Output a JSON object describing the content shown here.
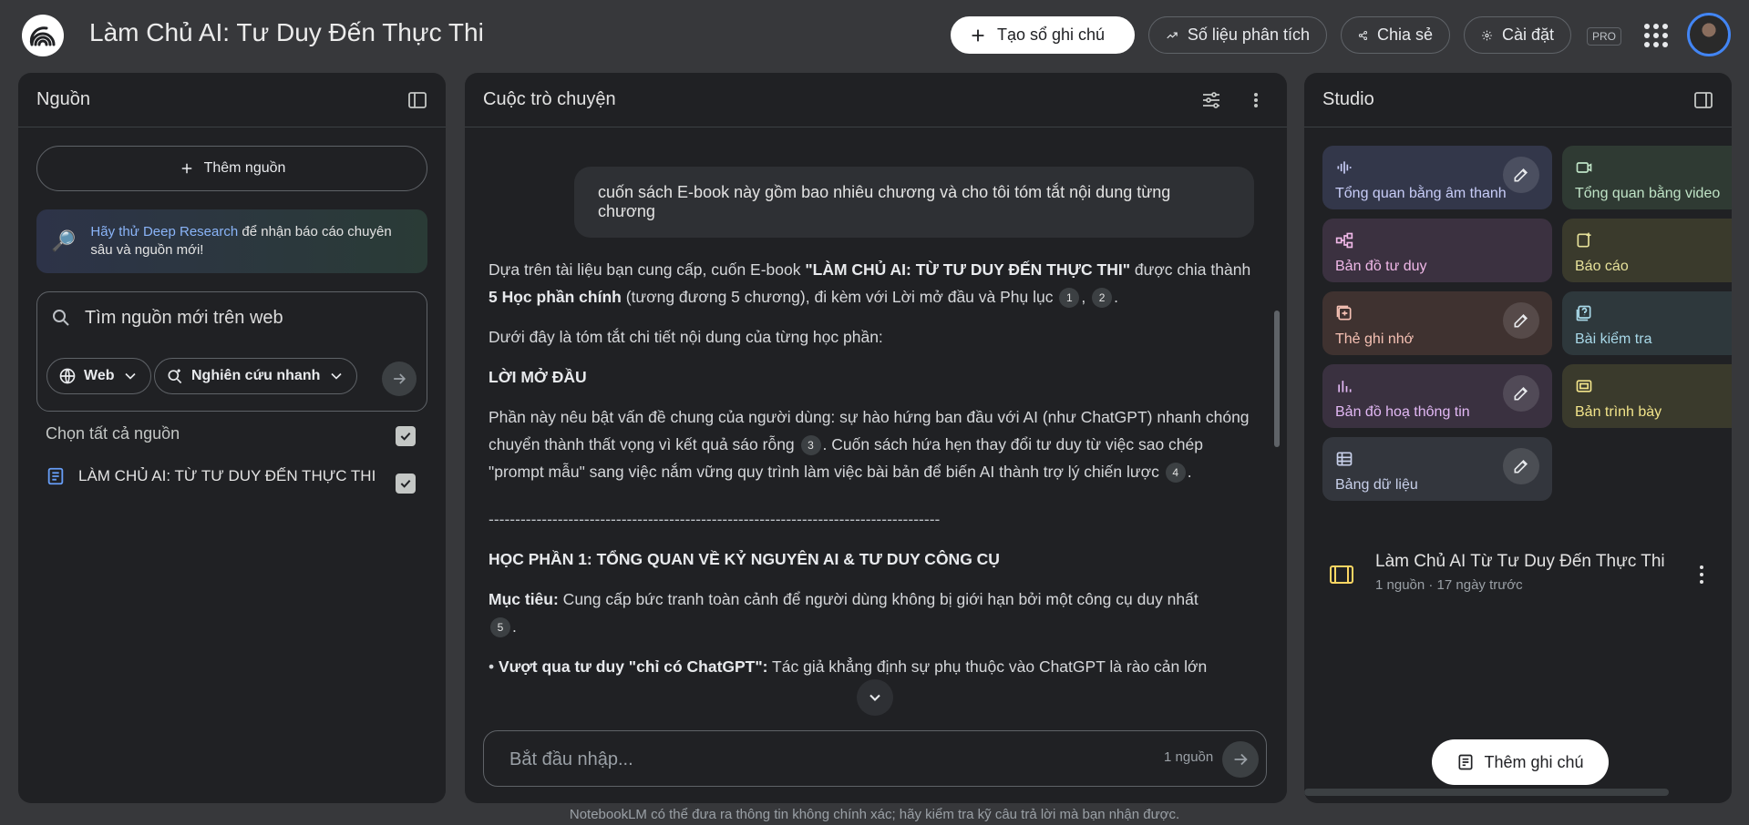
{
  "header": {
    "title": "Làm Chủ AI: Tư Duy Đến Thực Thi",
    "create_notebook": "Tạo sổ ghi chú",
    "analytics": "Số liệu phân tích",
    "share": "Chia sẻ",
    "settings": "Cài đặt",
    "badge": "PRO"
  },
  "sources": {
    "title": "Nguồn",
    "add_source": "Thêm nguồn",
    "deep_research_link": "Hãy thử Deep Research",
    "deep_research_text": " để nhận báo cáo chuyên sâu và nguồn mới!",
    "search_placeholder": "Tìm nguồn mới trên web",
    "chip_web": "Web",
    "chip_research": "Nghiên cứu nhanh",
    "select_all": "Chọn tất cả nguồn",
    "items": [
      {
        "label": "LÀM CHỦ AI: TỪ TƯ DUY ĐẾN THỰC THI",
        "checked": true
      }
    ]
  },
  "chat": {
    "title": "Cuộc trò chuyện",
    "user_message": "cuốn sách E-book này gồm bao nhiêu chương và cho tôi tóm tắt nội dung từng chương",
    "a1_pre": "Dựa trên tài liệu bạn cung cấp, cuốn E-book ",
    "a1_bold1": "\"LÀM CHỦ AI: TỪ TƯ DUY ĐẾN THỰC THI\"",
    "a1_mid": " được chia thành ",
    "a1_bold2": "5 Học phần chính",
    "a1_post": " (tương đương 5 chương), đi kèm với Lời mở đầu và Phụ lục ",
    "a1_sep": ",",
    "a1_end": ".",
    "c1": "1",
    "c2": "2",
    "a2": "Dưới đây là tóm tắt chi tiết nội dung của từng học phần:",
    "h1": "LỜI MỞ ĐẦU",
    "a3_pre": "Phần này nêu bật vấn đề chung của người dùng: sự hào hứng ban đầu với AI (như ChatGPT) nhanh chóng chuyển thành thất vọng vì kết quả sáo rỗng ",
    "c3": "3",
    "a3_post": ". Cuốn sách hứa hẹn thay đổi tư duy từ việc sao chép \"prompt mẫu\" sang việc nắm vững quy trình làm việc bài bản để biến AI thành trợ lý chiến lược ",
    "c4": "4",
    "a3_end": ".",
    "rule": "-------------------------------------------------------------------------------------",
    "h2": "HỌC PHẦN 1: TỔNG QUAN VỀ KỶ NGUYÊN AI & TƯ DUY CÔNG CỤ",
    "a4_label": "Mục tiêu:",
    "a4_text": " Cung cấp bức tranh toàn cảnh để người dùng không bị giới hạn bởi một công cụ duy nhất ",
    "c5": "5",
    "a4_end": ".",
    "a5_bullet": "• ",
    "a5_label": "Vượt qua tư duy \"chỉ có ChatGPT\":",
    "a5_text": " Tác giả khẳng định sự phụ thuộc vào ChatGPT là rào cản lớn",
    "input_placeholder": "Bắt đầu nhập...",
    "source_count": "1 nguồn"
  },
  "studio": {
    "title": "Studio",
    "tiles": [
      {
        "label": "Tổng quan bằng âm thanh",
        "icon": "audio-wave-icon",
        "bg": "#33374a",
        "fg": "#c8cdf8",
        "editable": true
      },
      {
        "label": "Tổng quan bằng video",
        "icon": "video-icon",
        "bg": "#2f3a33",
        "fg": "#bfe3c6",
        "editable": false
      },
      {
        "label": "Bản đồ tư duy",
        "icon": "mindmap-icon",
        "bg": "#3b3140",
        "fg": "#f0b8e8",
        "editable": false
      },
      {
        "label": "Báo cáo",
        "icon": "report-icon",
        "bg": "#3a3a2c",
        "fg": "#e6e19a",
        "editable": false
      },
      {
        "label": "Thẻ ghi nhớ",
        "icon": "flashcard-icon",
        "bg": "#3f3230",
        "fg": "#f6c1b4",
        "editable": true
      },
      {
        "label": "Bài kiểm tra",
        "icon": "quiz-icon",
        "bg": "#2e383c",
        "fg": "#a8d8e8",
        "editable": false
      },
      {
        "label": "Bản đồ hoạ thông tin",
        "icon": "infographic-icon",
        "bg": "#3a3140",
        "fg": "#e2b8f4",
        "editable": true
      },
      {
        "label": "Bản trình bày",
        "icon": "slides-icon",
        "bg": "#3a3a2c",
        "fg": "#f2e48a",
        "editable": false
      },
      {
        "label": "Bảng dữ liệu",
        "icon": "table-icon",
        "bg": "#33363d",
        "fg": "#c8d0ea",
        "editable": true
      }
    ],
    "note_title": "Làm Chủ AI Từ Tư Duy Đến Thực Thi",
    "note_meta": "1 nguồn · 17 ngày trước",
    "add_note": "Thêm ghi chú"
  },
  "footer": "NotebookLM có thể đưa ra thông tin không chính xác; hãy kiểm tra kỹ câu trả lời mà bạn nhận được."
}
